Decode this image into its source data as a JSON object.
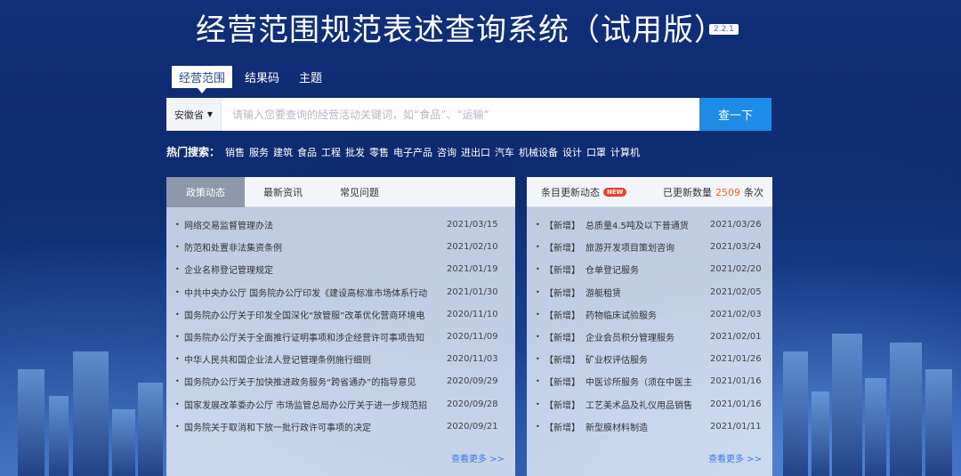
{
  "header": {
    "title": "经营范围规范表述查询系统（试用版）",
    "version": "2.2.1"
  },
  "tabs": [
    {
      "label": "经营范围"
    },
    {
      "label": "结果码"
    },
    {
      "label": "主题"
    }
  ],
  "search": {
    "province": "安徽省",
    "placeholder": "请输入您要查询的经营活动关键词，如“食品”、“运输”",
    "button": "查一下"
  },
  "hot": {
    "label": "热门搜索：",
    "items": [
      "销售",
      "服务",
      "建筑",
      "食品",
      "工程",
      "批发",
      "零售",
      "电子产品",
      "咨询",
      "进出口",
      "汽车",
      "机械设备",
      "设计",
      "口罩",
      "计算机"
    ]
  },
  "left_panel": {
    "tabs": [
      "政策动态",
      "最新资讯",
      "常见问题"
    ],
    "items": [
      {
        "text": "网络交易监督管理办法",
        "date": "2021/03/15"
      },
      {
        "text": "防范和处置非法集资条例",
        "date": "2021/02/10"
      },
      {
        "text": "企业名称登记管理规定",
        "date": "2021/01/19"
      },
      {
        "text": "中共中央办公厅 国务院办公厅印发《建设高标准市场体系行动",
        "date": "2021/01/30"
      },
      {
        "text": "国务院办公厅关于印发全国深化“放管服”改革优化营商环境电",
        "date": "2020/11/10"
      },
      {
        "text": "国务院办公厅关于全面推行证明事项和涉企经营许可事项告知",
        "date": "2020/11/09"
      },
      {
        "text": "中华人民共和国企业法人登记管理条例施行细则",
        "date": "2020/11/03"
      },
      {
        "text": "国务院办公厅关于加快推进政务服务“跨省通办”的指导意见",
        "date": "2020/09/29"
      },
      {
        "text": "国家发展改革委办公厅 市场监管总局办公厅关于进一步规范招",
        "date": "2020/09/28"
      },
      {
        "text": "国务院关于取消和下放一批行政许可事项的决定",
        "date": "2020/09/21"
      }
    ],
    "more": "查看更多 >>"
  },
  "right_panel": {
    "title": "条目更新动态",
    "badge": "NEW",
    "count_prefix": "已更新数量",
    "count": "2509",
    "count_suffix": "条次",
    "items": [
      {
        "tag": "【新增】",
        "text": "总质量4.5吨及以下普通货",
        "date": "2021/03/26"
      },
      {
        "tag": "【新增】",
        "text": "旅游开发项目策划咨询",
        "date": "2021/03/24"
      },
      {
        "tag": "【新增】",
        "text": "仓单登记服务",
        "date": "2021/02/20"
      },
      {
        "tag": "【新增】",
        "text": "游艇租赁",
        "date": "2021/02/05"
      },
      {
        "tag": "【新增】",
        "text": "药物临床试验服务",
        "date": "2021/02/03"
      },
      {
        "tag": "【新增】",
        "text": "企业会员积分管理服务",
        "date": "2021/02/01"
      },
      {
        "tag": "【新增】",
        "text": "矿业权评估服务",
        "date": "2021/01/26"
      },
      {
        "tag": "【新增】",
        "text": "中医诊所服务（须在中医主",
        "date": "2021/01/16"
      },
      {
        "tag": "【新增】",
        "text": "工艺美术品及礼仪用品销售",
        "date": "2021/01/16"
      },
      {
        "tag": "【新增】",
        "text": "新型膜材料制造",
        "date": "2021/01/11"
      }
    ],
    "more": "查看更多 >>"
  }
}
